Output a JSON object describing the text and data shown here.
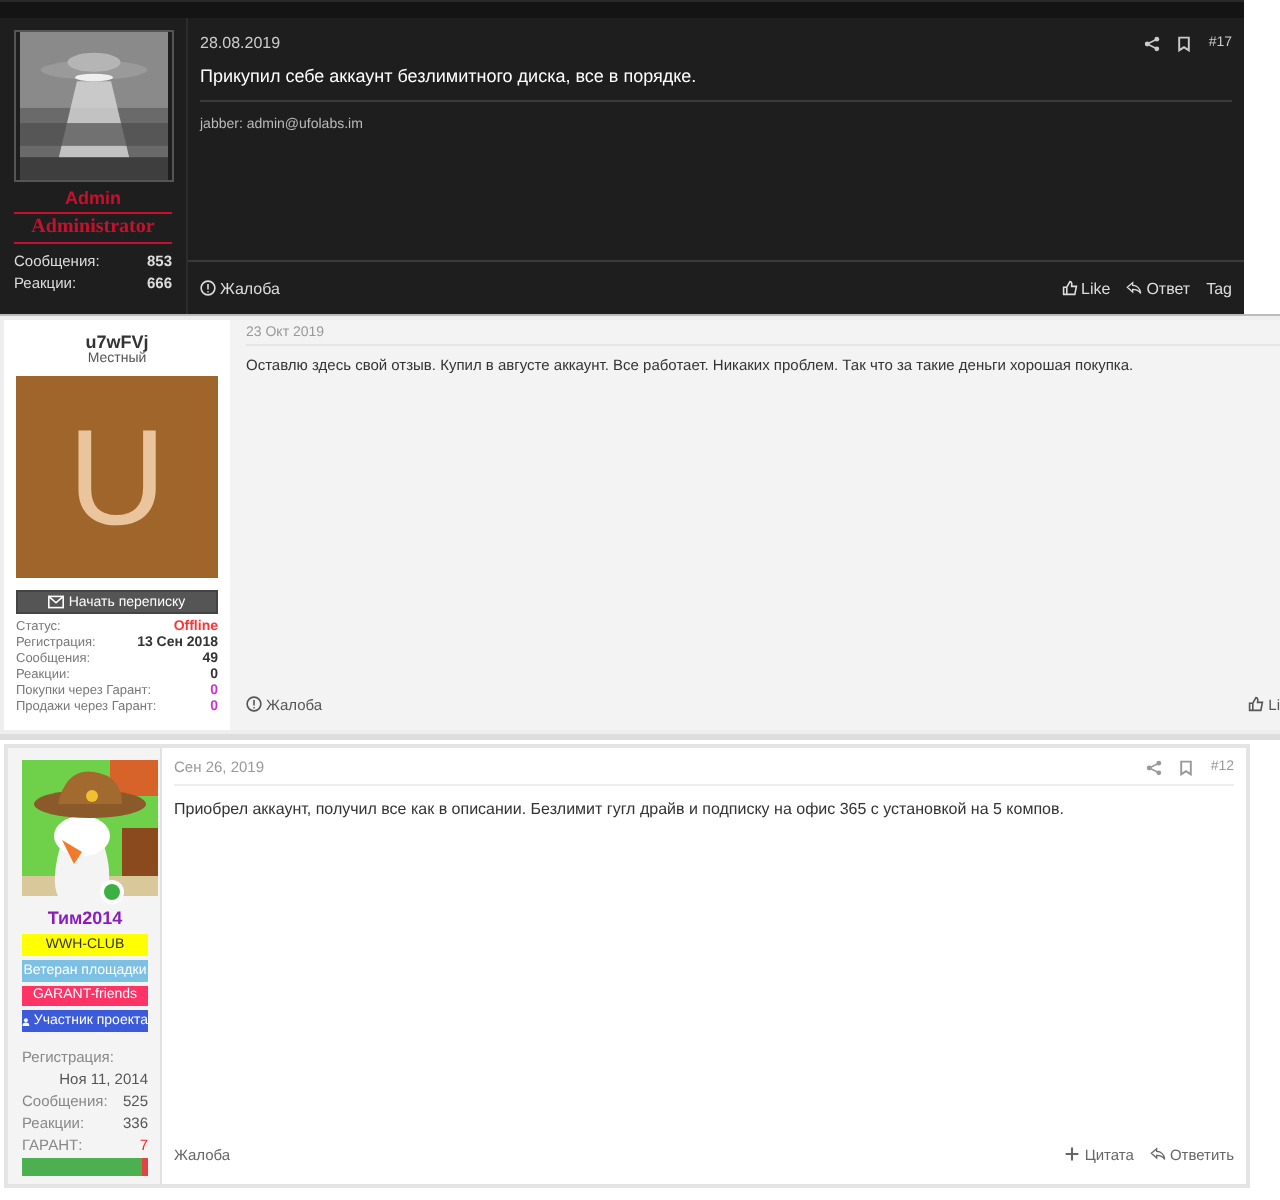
{
  "posts": [
    {
      "kind": "dark",
      "date": "28.08.2019",
      "number": "#17",
      "message": "Прикупил себе аккаунт безлимитного диска, все в порядке.",
      "signature": "jabber: admin@ufolabs.im",
      "user": {
        "name": "Admin",
        "title": "Administrator"
      },
      "stats": [
        {
          "label": "Сообщения:",
          "value": "853"
        },
        {
          "label": "Реакции:",
          "value": "666"
        }
      ],
      "footer_left": [
        {
          "kind": "report",
          "label": "Жалоба"
        }
      ],
      "footer_right": [
        {
          "kind": "like",
          "label": "Like"
        },
        {
          "kind": "reply",
          "label": "Ответ"
        },
        {
          "kind": "plain",
          "label": "Tag"
        }
      ]
    },
    {
      "kind": "gray",
      "date": "23 Окт 2019",
      "message": "Оставлю здесь свой отзыв. Купил в августе аккаунт. Все работает. Никаких проблем. Так что за такие деньги хорошая покупка.",
      "user": {
        "name": "u7wFVj",
        "rank": "Местный",
        "avatar": {
          "kind": "letter",
          "letter": "U",
          "color": "#a0652a"
        },
        "message_button": "Начать переписку"
      },
      "stats": [
        {
          "label": "Статус:",
          "value": "Offline",
          "color": "#ff3333"
        },
        {
          "label": "Регистрация:",
          "value": "13 Сен 2018",
          "color": "#333333"
        },
        {
          "label": "Сообщения:",
          "value": "49",
          "color": "#333333"
        },
        {
          "label": "Реакции:",
          "value": "0",
          "color": "#333333"
        },
        {
          "label": "Покупки через Гарант:",
          "value": "0",
          "color": "#cc33cc"
        },
        {
          "label": "Продажи через Гарант:",
          "value": "0",
          "color": "#cc33cc"
        }
      ],
      "footer_left": [
        {
          "kind": "report",
          "label": "Жалоба"
        }
      ],
      "footer_right": [
        {
          "kind": "like",
          "label": "Li"
        }
      ]
    },
    {
      "kind": "white",
      "date": "Сен 26, 2019",
      "number": "#12",
      "message": "Приобрел аккаунт, получил все как в описании. Безлимит гугл драйв и подписку на офис 365 с установкой на 5 компов.",
      "user": {
        "name": "Тим2014",
        "online": true,
        "badges": [
          {
            "label": "WWH-CLUB",
            "color": "#ffff00",
            "kind": "plain"
          },
          {
            "label": "Ветеран площадки",
            "color": "#7cc0e4",
            "kind": "plain"
          },
          {
            "label": "GARANT-friends",
            "color": "#ff3366",
            "kind": "plain"
          },
          {
            "label": "Участник проекта",
            "color": "#3b5bdb",
            "kind": "member"
          }
        ],
        "level": 0.96
      },
      "stats": [
        {
          "label": "Регистрация:",
          "value": "Ноя 11, 2014",
          "kind": "stacked"
        },
        {
          "label": "Сообщения:",
          "value": "525"
        },
        {
          "label": "Реакции:",
          "value": "336"
        },
        {
          "label": "ГАРАНТ:",
          "value": "7",
          "color": "#ff2222"
        }
      ],
      "footer_left": [
        {
          "kind": "plain",
          "label": "Жалоба"
        }
      ],
      "footer_right": [
        {
          "kind": "quote",
          "label": "Цитата"
        },
        {
          "kind": "reply",
          "label": "Ответить"
        }
      ]
    }
  ]
}
